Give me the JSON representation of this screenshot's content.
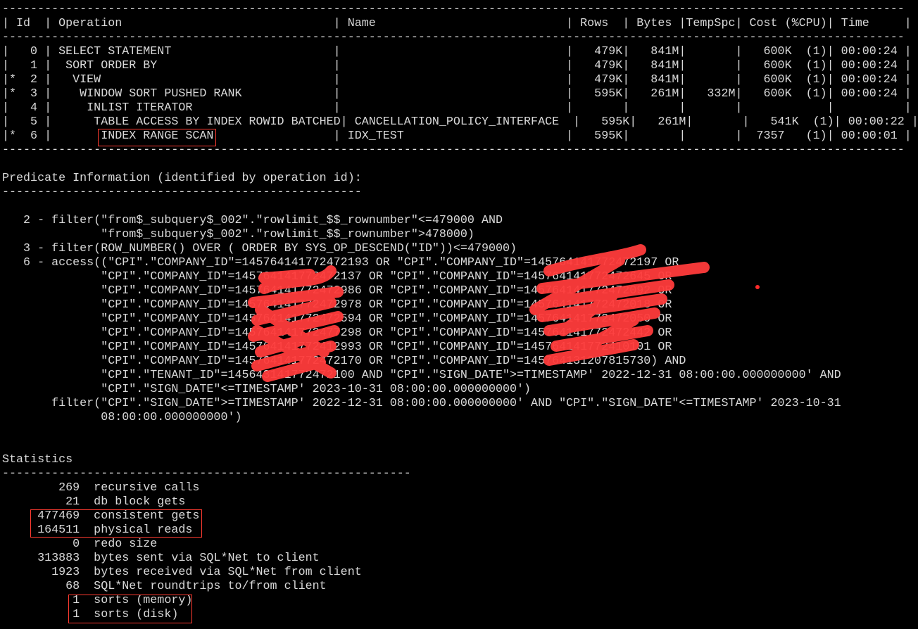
{
  "terminal": {
    "lines": [
      "--------------------------------------------------------------------------------------------------------------------------------",
      "| Id  | Operation                              | Name                           | Rows  | Bytes |TempSpc| Cost (%CPU)| Time     |",
      "--------------------------------------------------------------------------------------------------------------------------------",
      "|   0 | SELECT STATEMENT                       |                                |   479K|   841M|       |   600K  (1)| 00:00:24 |",
      "|   1 |  SORT ORDER BY                         |                                |   479K|   841M|       |   600K  (1)| 00:00:24 |",
      "|*  2 |   VIEW                                 |                                |   479K|   841M|       |   600K  (1)| 00:00:24 |",
      "|*  3 |    WINDOW SORT PUSHED RANK             |                                |   595K|   261M|   332M|   600K  (1)| 00:00:24 |",
      "|   4 |     INLIST ITERATOR                    |                                |       |       |       |            |          |",
      "|   5 |      TABLE ACCESS BY INDEX ROWID BATCHED| CANCELLATION_POLICY_INTERFACE  |   595K|   261M|       |   541K  (1)| 00:00:22 |",
      "|*  6 |       INDEX RANGE SCAN                 | IDX_TEST                       |   595K|       |       |  7357   (1)| 00:00:01 |",
      "--------------------------------------------------------------------------------------------------------------------------------",
      "",
      "Predicate Information (identified by operation id):",
      "---------------------------------------------------",
      "",
      "   2 - filter(\"from$_subquery$_002\".\"rowlimit_$$_rownumber\"<=479000 AND",
      "              \"from$_subquery$_002\".\"rowlimit_$$_rownumber\">478000)",
      "   3 - filter(ROW_NUMBER() OVER ( ORDER BY SYS_OP_DESCEND(\"ID\"))<=479000)",
      "   6 - access((\"CPI\".\"COMPANY_ID\"=145764141772472193 OR \"CPI\".\"COMPANY_ID\"=145764141772472197 OR",
      "              \"CPI\".\"COMPANY_ID\"=145764141772472137 OR \"CPI\".\"COMPANY_ID\"=145764141772472645 OR",
      "              \"CPI\".\"COMPANY_ID\"=145764141772472986 OR \"CPI\".\"COMPANY_ID\"=145764141772472092 OR",
      "              \"CPI\".\"COMPANY_ID\"=145764141772472978 OR \"CPI\".\"COMPANY_ID\"=145764141772472018 OR",
      "              \"CPI\".\"COMPANY_ID\"=145764141772472594 OR \"CPI\".\"COMPANY_ID\"=145764141772472050 OR",
      "              \"CPI\".\"COMPANY_ID\"=145764141772477298 OR \"CPI\".\"COMPANY_ID\"=145764141772472442 OR",
      "              \"CPI\".\"COMPANY_ID\"=145764141772412993 OR \"CPI\".\"COMPANY_ID\"=145764141772410101 OR",
      "              \"CPI\".\"COMPANY_ID\"=145764141772472170 OR \"CPI\".\"COMPANY_ID\"=145764131207815730) AND",
      "              \"CPI\".\"TENANT_ID\"=145643141772472100 AND \"CPI\".\"SIGN_DATE\">=TIMESTAMP' 2022-12-31 08:00:00.000000000' AND",
      "              \"CPI\".\"SIGN_DATE\"<=TIMESTAMP' 2023-10-31 08:00:00.000000000')",
      "       filter(\"CPI\".\"SIGN_DATE\">=TIMESTAMP' 2022-12-31 08:00:00.000000000' AND \"CPI\".\"SIGN_DATE\"<=TIMESTAMP' 2023-10-31",
      "              08:00:00.000000000')",
      "",
      "",
      "Statistics",
      "----------------------------------------------------------",
      "        269  recursive calls",
      "         21  db block gets",
      "     477469  consistent gets",
      "     164511  physical reads",
      "          0  redo size",
      "     313883  bytes sent via SQL*Net to client",
      "       1923  bytes received via SQL*Net from client",
      "         68  SQL*Net roundtrips to/from client",
      "          1  sorts (memory)",
      "          1  sorts (disk)"
    ]
  },
  "colors": {
    "background": "#000000",
    "text": "#d9d9d9",
    "highlight_box": "#ff3b30",
    "redaction": "#ff3b3b"
  }
}
